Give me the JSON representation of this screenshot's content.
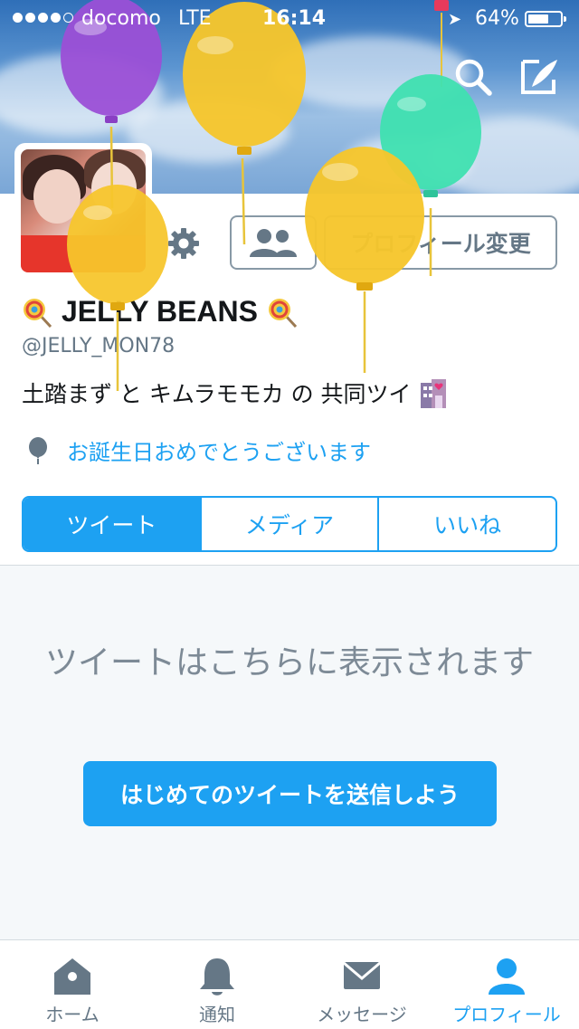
{
  "status_bar": {
    "carrier": "docomo",
    "network": "LTE",
    "time": "16:14",
    "battery_percent": "64%",
    "battery_level": 0.64
  },
  "header_actions": {
    "search_icon": "search-icon",
    "compose_icon": "compose-icon"
  },
  "profile": {
    "name": "JELLY BEANS",
    "name_emoji": "lollipop",
    "handle": "@JELLY_MON78",
    "bio": "土踏まず と キムラモモカ の 共同ツイ",
    "bio_emoji": "love-hotel",
    "birthday_text": "お誕生日おめでとうございます",
    "edit_profile_label": "プロフィール変更",
    "settings_icon": "gear-icon",
    "follow_icon": "people-icon"
  },
  "tabs": [
    {
      "label": "ツイート",
      "active": true
    },
    {
      "label": "メディア",
      "active": false
    },
    {
      "label": "いいね",
      "active": false
    }
  ],
  "empty_state": {
    "message": "ツイートはこちらに表示されます",
    "cta_label": "はじめてのツイートを送信しよう"
  },
  "tab_bar": [
    {
      "label": "ホーム",
      "icon": "home-icon",
      "active": false
    },
    {
      "label": "通知",
      "icon": "bell-icon",
      "active": false
    },
    {
      "label": "メッセージ",
      "icon": "envelope-icon",
      "active": false
    },
    {
      "label": "プロフィール",
      "icon": "person-icon",
      "active": true
    }
  ],
  "colors": {
    "accent": "#1da1f2",
    "muted": "#657786"
  }
}
